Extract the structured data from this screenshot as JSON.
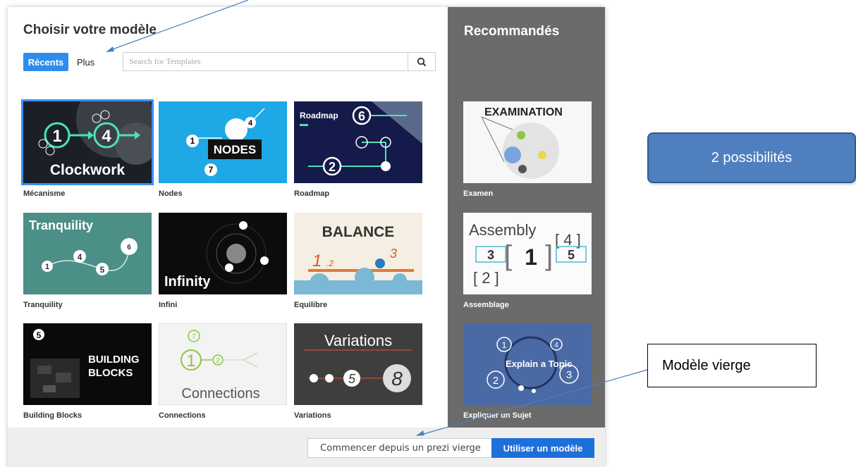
{
  "dialog": {
    "title": "Choisir votre modèle",
    "tabs": {
      "recents": "Récents",
      "plus": "Plus"
    },
    "search": {
      "placeholder": "Search for Templates",
      "value": ""
    },
    "templates": [
      {
        "label": "Mécanisme",
        "thumb_text": "Clockwork"
      },
      {
        "label": "Nodes",
        "thumb_text": "NODES"
      },
      {
        "label": "Roadmap",
        "thumb_text": "Roadmap"
      },
      {
        "label": "Tranquility",
        "thumb_text": "Tranquility"
      },
      {
        "label": "Infini",
        "thumb_text": "Infinity"
      },
      {
        "label": "Equilibre",
        "thumb_text": "BALANCE"
      },
      {
        "label": "Building Blocks",
        "thumb_text": "BUILDING BLOCKS"
      },
      {
        "label": "Connections",
        "thumb_text": "Connections"
      },
      {
        "label": "Variations",
        "thumb_text": "Variations"
      }
    ],
    "sidebar": {
      "title": "Recommandés",
      "items": [
        {
          "label": "Examen",
          "thumb_text": "EXAMINATION"
        },
        {
          "label": "Assemblage",
          "thumb_text": "Assembly"
        },
        {
          "label": "Expliquer un Sujet",
          "thumb_text": "Explain a Topic"
        }
      ]
    },
    "footer": {
      "blank_button": "Commencer depuis un prezi vierge",
      "use_button": "Utiliser un modèle"
    }
  },
  "annotations": {
    "callout_blue": "2 possibilités",
    "callout_box": "Modèle vierge"
  },
  "colors": {
    "accent": "#2d8ded",
    "primary_button": "#1e6fd9",
    "sidebar_bg": "#6b6b6b",
    "callout_blue": "#4f7fbf",
    "arrow": "#4a7fc1"
  },
  "icons": {
    "search_button": "search-icon"
  }
}
